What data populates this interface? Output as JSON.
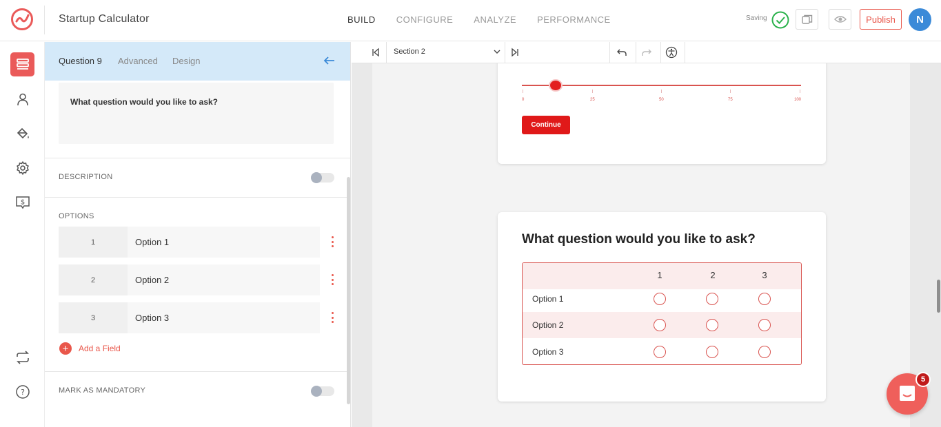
{
  "header": {
    "app_title": "Startup Calculator",
    "nav": [
      "BUILD",
      "CONFIGURE",
      "ANALYZE",
      "PERFORMANCE"
    ],
    "active_nav": "BUILD",
    "saving_label": "Saving",
    "publish_label": "Publish",
    "avatar_initial": "N",
    "accent_color": "#e9574b"
  },
  "sidebar": {
    "items": [
      "builder-icon",
      "user-icon",
      "paint-bucket-icon",
      "gear-icon",
      "pricing-icon",
      "switch-icon",
      "help-icon"
    ]
  },
  "panel": {
    "tabs": [
      "Question 9",
      "Advanced",
      "Design"
    ],
    "question_text": "What question would you like to ask?",
    "description_label": "DESCRIPTION",
    "options_label": "OPTIONS",
    "options": [
      {
        "num": "1",
        "label": "Option 1"
      },
      {
        "num": "2",
        "label": "Option 2"
      },
      {
        "num": "3",
        "label": "Option 3"
      }
    ],
    "add_field_label": "Add a Field",
    "mandatory_label": "MARK AS MANDATORY"
  },
  "canvas": {
    "section_select": "Section 2",
    "slider_ticks": [
      "0",
      "25",
      "50",
      "75",
      "100"
    ],
    "slider_value": 12,
    "continue_label": "Continue",
    "question_title": "What question would you like to ask?",
    "matrix_columns": [
      "1",
      "2",
      "3"
    ],
    "matrix_rows": [
      "Option 1",
      "Option 2",
      "Option 3"
    ]
  },
  "chat": {
    "badge_count": "5"
  }
}
